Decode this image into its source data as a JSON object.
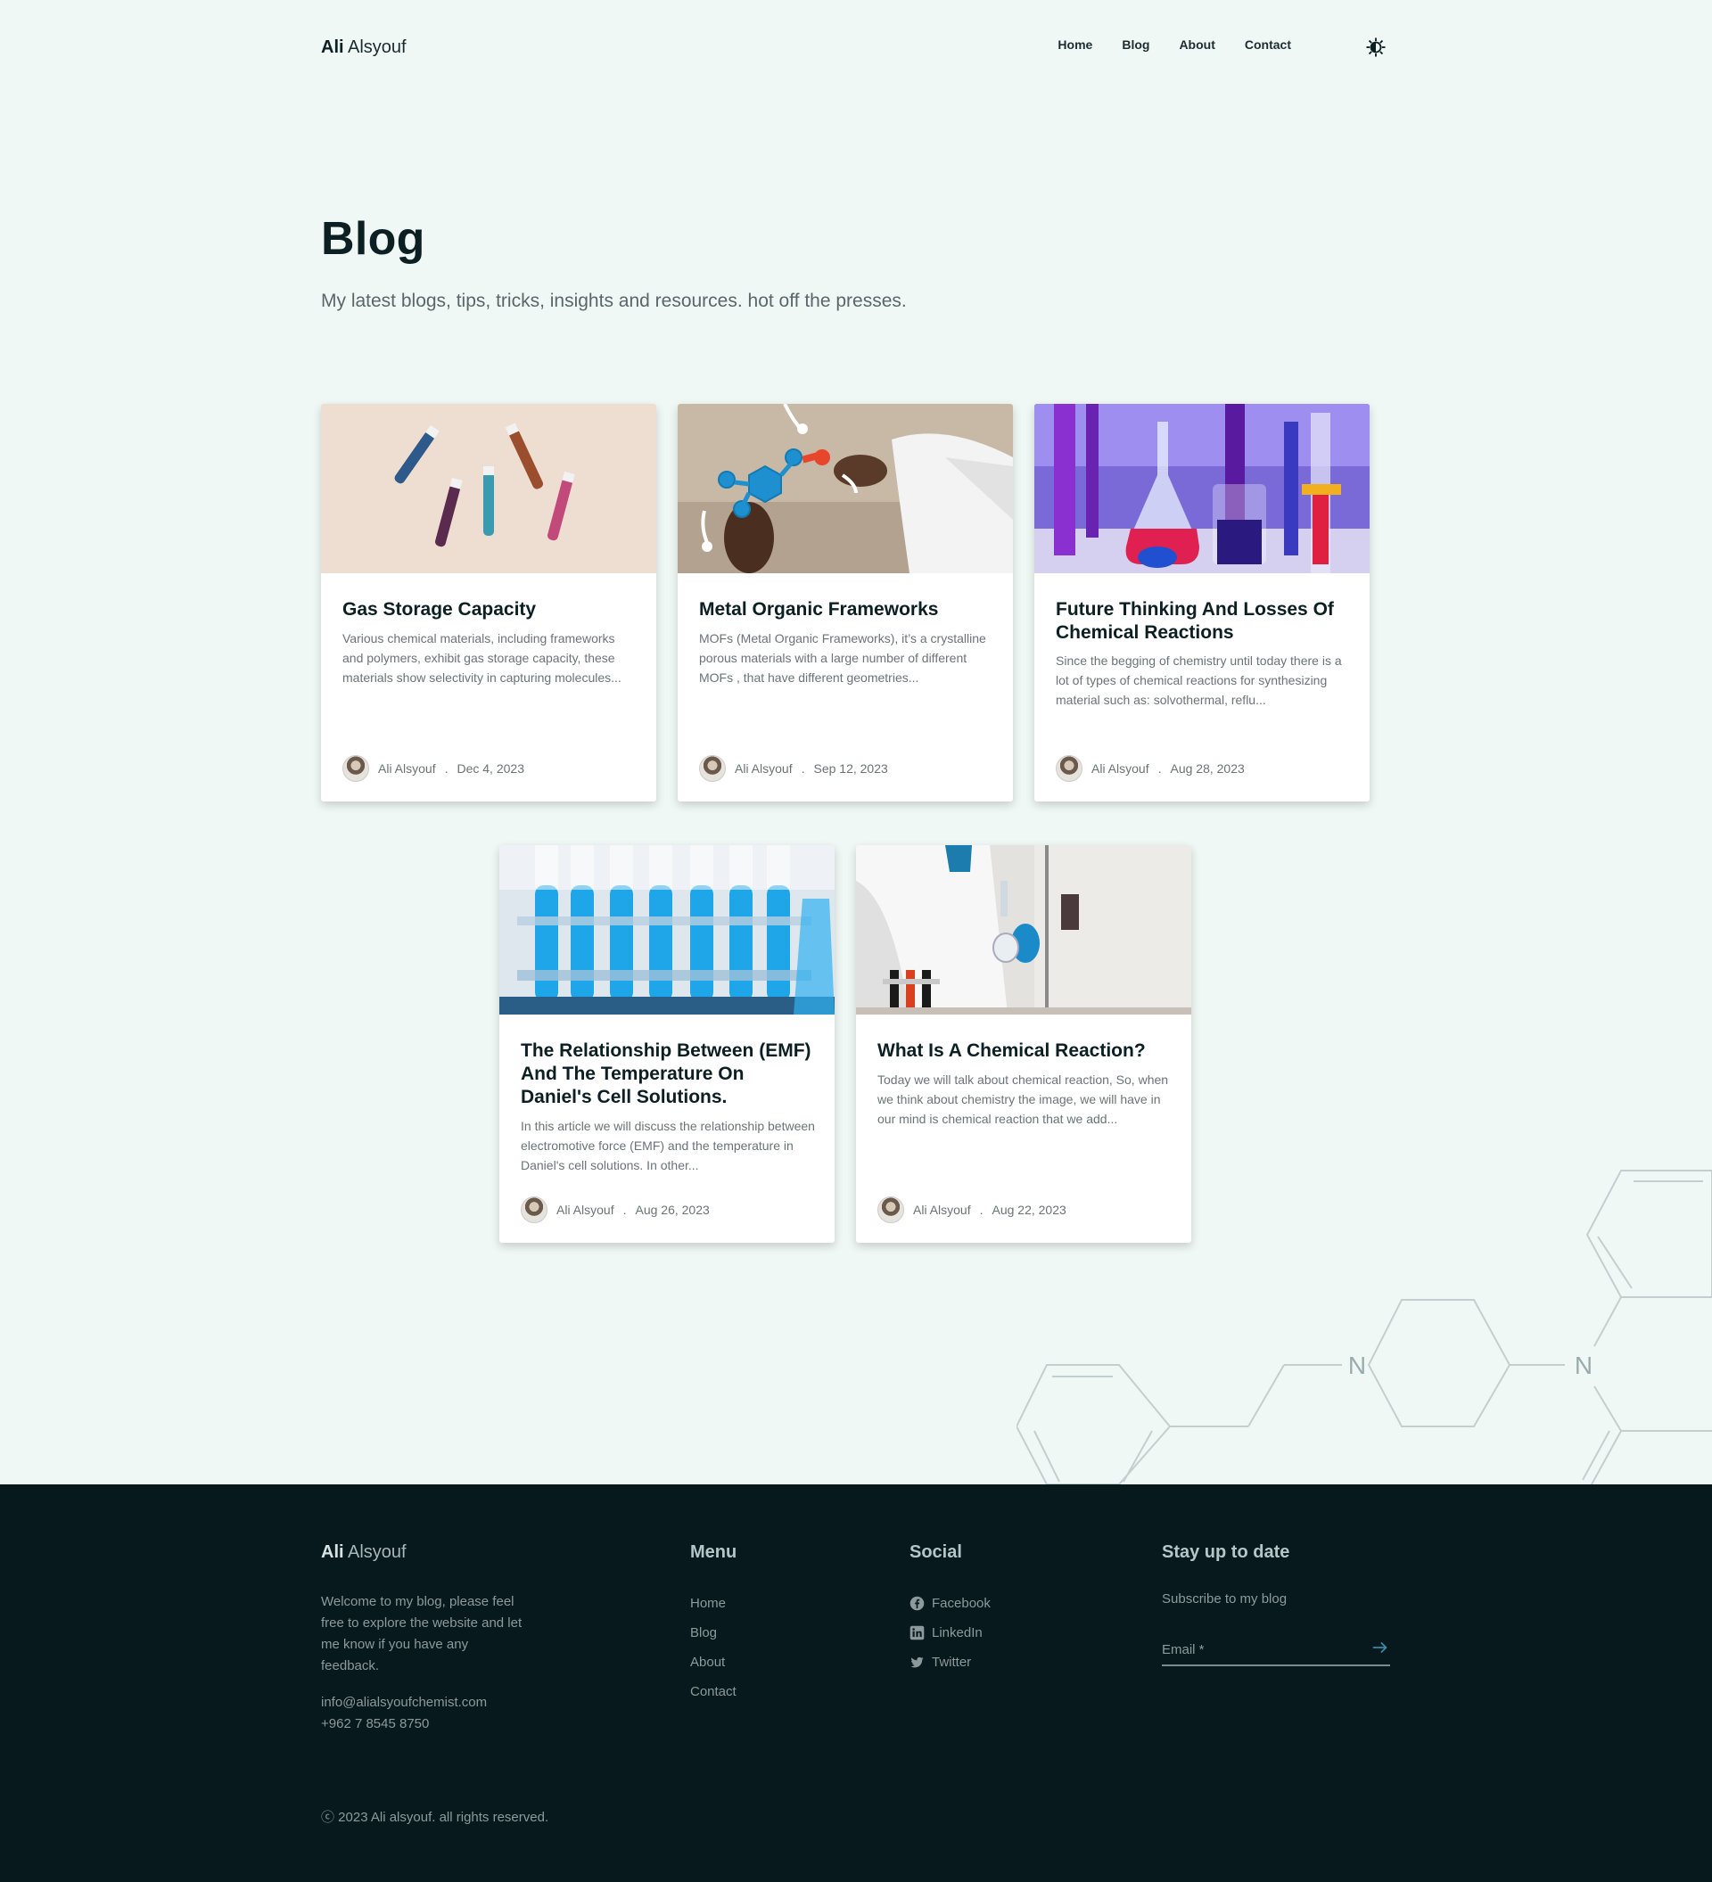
{
  "header": {
    "logo_first": "Ali",
    "logo_last": "Alsyouf",
    "nav": [
      "Home",
      "Blog",
      "About",
      "Contact"
    ],
    "theme_icon": "theme-toggle-icon"
  },
  "hero": {
    "title": "Blog",
    "subtitle": "My latest blogs, tips, tricks, insights and resources. hot off the presses."
  },
  "posts": [
    {
      "title": "Gas Storage Capacity",
      "excerpt": "Various chemical materials, including frameworks and polymers, exhibit gas storage capacity, these materials show selectivity in capturing molecules...",
      "author": "Ali Alsyouf",
      "date": "Dec 4, 2023",
      "image": "test-tubes-glitter"
    },
    {
      "title": "Metal Organic Frameworks",
      "excerpt": "MOFs (Metal Organic Frameworks), it’s a crystalline porous materials with a large number of different MOFs , that have different geometries...",
      "author": "Ali Alsyouf",
      "date": "Sep 12, 2023",
      "image": "molecular-model"
    },
    {
      "title": "Future Thinking And Losses Of Chemical Reactions",
      "excerpt": "Since the begging of chemistry until today there is a lot of types of chemical reactions for synthesizing material such as: solvothermal, reflu...",
      "author": "Ali Alsyouf",
      "date": "Aug 28, 2023",
      "image": "colored-flasks"
    },
    {
      "title": "The Relationship Between (EMF) And The Temperature On Daniel's Cell Solutions.",
      "excerpt": "In this article we will discuss the relationship between electromotive force (EMF) and the temperature in Daniel's cell solutions. In other...",
      "author": "Ali Alsyouf",
      "date": "Aug 26, 2023",
      "image": "blue-test-tubes"
    },
    {
      "title": "What Is A Chemical Reaction?",
      "excerpt": "Today we will talk about chemical reaction, So, when we think about chemistry the image, we will have in our mind is chemical reaction that we add...",
      "author": "Ali Alsyouf",
      "date": "Aug 22, 2023",
      "image": "lab-scientist"
    }
  ],
  "decoration": {
    "atom_labels": [
      "N",
      "N"
    ]
  },
  "footer": {
    "logo_first": "Ali",
    "logo_last": "Alsyouf",
    "about": "Welcome to my blog, please feel free to explore the website and let me know if you have any feedback.",
    "email": "info@alialsyoufchemist.com",
    "phone": "+962 7 8545 8750",
    "menu_title": "Menu",
    "menu": [
      "Home",
      "Blog",
      "About",
      "Contact"
    ],
    "social_title": "Social",
    "social": [
      {
        "label": "Facebook",
        "icon": "facebook-icon"
      },
      {
        "label": "LinkedIn",
        "icon": "linkedin-icon"
      },
      {
        "label": "Twitter",
        "icon": "twitter-icon"
      }
    ],
    "newsletter_title": "Stay up to date",
    "newsletter_sub": "Subscribe to my blog",
    "email_placeholder": "Email *",
    "submit_icon": "arrow-right-icon",
    "copyright": "ⓒ 2023 Ali alsyouf. all rights reserved."
  },
  "colors": {
    "page_bg": "#f0f8f6",
    "footer_bg": "#07191d",
    "heading": "#0c1f22",
    "muted": "#6a7476"
  }
}
